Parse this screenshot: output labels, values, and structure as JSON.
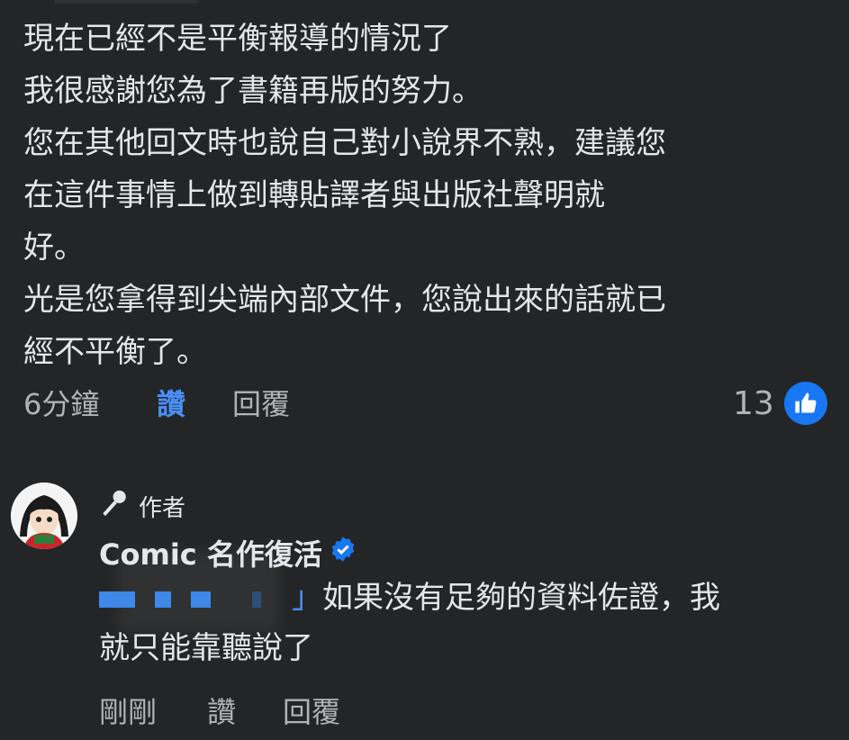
{
  "first_comment": {
    "lines": [
      "現在已經不是平衡報導的情況了",
      "我很感謝您為了書籍再版的努力。",
      "您在其他回文時也說自己對小說界不熟，建議您",
      "在這件事情上做到轉貼譯者與出版社聲明就",
      "好。",
      "光是您拿得到尖端內部文件，您說出來的話就已",
      "經不平衡了。"
    ],
    "time": "6分鐘",
    "like_label": "讚",
    "reply_label": "回覆",
    "like_count": "13",
    "like_icon": "thumbs-up-icon"
  },
  "reply_comment": {
    "author_badge": "作者",
    "author_badge_icon": "microphone-icon",
    "author_name": "Comic 名作復活",
    "verified_icon": "verified-badge-icon",
    "mention_visible": "」",
    "text_line1": "如果沒有足夠的資料佐證，我",
    "text_line2": "就只能靠聽說了",
    "time": "剛剛",
    "like_label": "讚",
    "reply_label": "回覆"
  },
  "colors": {
    "background": "#242526",
    "text": "#e4e6eb",
    "secondary": "#b0b3b8",
    "link_blue": "#4b8ff7",
    "like_badge": "#1877f2"
  }
}
